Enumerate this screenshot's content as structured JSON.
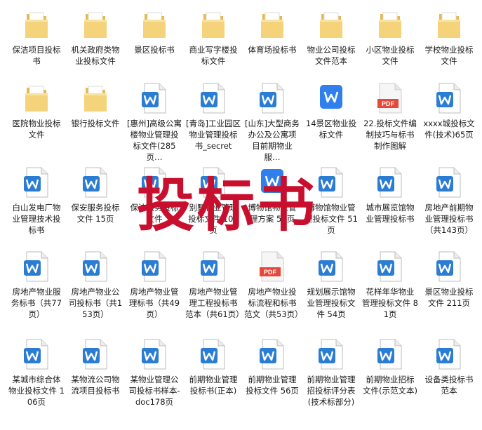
{
  "overlay_title": "投标书",
  "items": [
    {
      "kind": "folder",
      "label": "保洁项目投标书"
    },
    {
      "kind": "folder",
      "label": "机关政府类物业投标文件"
    },
    {
      "kind": "folder",
      "label": "景区投标书"
    },
    {
      "kind": "folder",
      "label": "商业写字楼投标文件"
    },
    {
      "kind": "folder",
      "label": "体育场投标书"
    },
    {
      "kind": "folder",
      "label": "物业公司投标文件范本"
    },
    {
      "kind": "folder",
      "label": "小区物业投标文件"
    },
    {
      "kind": "folder",
      "label": "学校物业投标文件"
    },
    {
      "kind": "folder",
      "label": "医院物业投标文件"
    },
    {
      "kind": "folder",
      "label": "银行投标文件"
    },
    {
      "kind": "word",
      "label": "[惠州]高级公寓楼物业管理投标文件(285页…"
    },
    {
      "kind": "word",
      "label": "[青岛]工业园区物业管理投标书_secret"
    },
    {
      "kind": "word",
      "label": "[山东]大型商务办公及公寓项目前期物业服…"
    },
    {
      "kind": "wps",
      "label": "14景区物业投标文件"
    },
    {
      "kind": "pdf",
      "label": "22.投标文件编制技巧与标书制作图解"
    },
    {
      "kind": "word",
      "label": "xxxx城投标文件(技术)65页"
    },
    {
      "kind": "word",
      "label": "白山发电厂物业管理技术投标书"
    },
    {
      "kind": "word",
      "label": "保安服务投标文件 15页"
    },
    {
      "kind": "word",
      "label": "保洁服务投标文件"
    },
    {
      "kind": "word",
      "label": "别墅物业管理投标文件 106页"
    },
    {
      "kind": "wps",
      "label": "博物馆物业管理方案 58页"
    },
    {
      "kind": "word",
      "label": "博物馆物业管理投标文件 51页"
    },
    {
      "kind": "word",
      "label": "城市展览馆物业管理投标书"
    },
    {
      "kind": "word",
      "label": "房地产前期物业管理投标书（共143页）"
    },
    {
      "kind": "word",
      "label": "房地产物业服务标书（共77页）"
    },
    {
      "kind": "word",
      "label": "房地产物业公司投标书（共153页）"
    },
    {
      "kind": "word",
      "label": "房地产物业管理标书（共49页）"
    },
    {
      "kind": "word",
      "label": "房地产物业管理工程投标书范本（共61页）"
    },
    {
      "kind": "pdf",
      "label": "房地产物业投标流程和标书范文（共53页）"
    },
    {
      "kind": "word",
      "label": "规划展示馆物业管理投标文件 54页"
    },
    {
      "kind": "word",
      "label": "花样年华物业管理投标文件 81页"
    },
    {
      "kind": "word",
      "label": "景区物业投标文件 211页"
    },
    {
      "kind": "word",
      "label": "某城市综合体物业投标文件 106页"
    },
    {
      "kind": "word",
      "label": "某物流公司物流项目投标书"
    },
    {
      "kind": "word",
      "label": "某物业管理公司投标书样本-doc178页"
    },
    {
      "kind": "word",
      "label": "前期物业管理投标书(正本)"
    },
    {
      "kind": "word",
      "label": "前期物业管理投标文件 56页"
    },
    {
      "kind": "word",
      "label": "前期物业管理招投标评分表(技术标部分)"
    },
    {
      "kind": "word",
      "label": "前期物业招标文件(示范文本)"
    },
    {
      "kind": "word",
      "label": "设备类投标书范本"
    }
  ],
  "colors": {
    "folder_body": "#f5d37a",
    "folder_back": "#e9b84a",
    "word_blue": "#2b7cd3",
    "wps_blue": "#2f80ed",
    "pdf_red": "#e5493a",
    "overlay_red": "#c8102e"
  }
}
